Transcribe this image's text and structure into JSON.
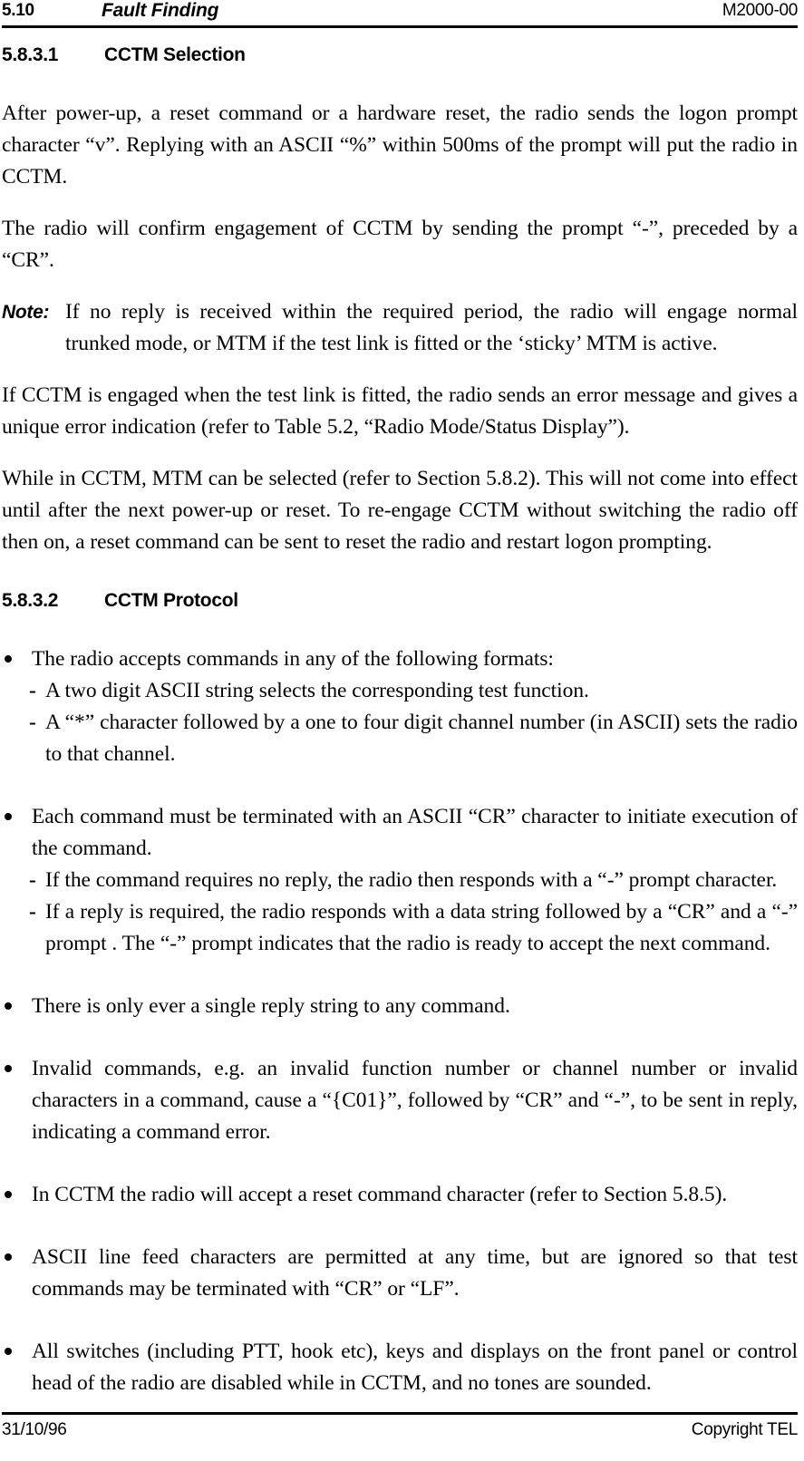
{
  "header": {
    "section_number": "5.10",
    "title": "Fault Finding",
    "document_number": "M2000-00"
  },
  "footer": {
    "date": "31/10/96",
    "copyright": "Copyright TEL"
  },
  "sections": [
    {
      "number": "5.8.3.1",
      "title": "CCTM Selection"
    },
    {
      "number": "5.8.3.2",
      "title": "CCTM Protocol"
    }
  ],
  "paragraphs": {
    "p1": "After power-up, a reset command or a hardware reset, the radio sends the logon prompt character “v”. Replying with an ASCII “%” within 500ms of the prompt will put the radio in CCTM.",
    "p2": "The radio will confirm engagement of CCTM by sending the prompt “-”, preceded by a “CR”.",
    "p3": "If CCTM is engaged when the test link is fitted, the radio sends an error message and gives a unique error indication (refer to Table 5.2, “Radio Mode/Status Display”).",
    "p4": "While in CCTM, MTM can be selected (refer to Section 5.8.2). This will not come into effect until after the next power-up or reset. To re-engage CCTM without switching the radio off then on, a reset command can be sent to reset the radio and restart logon prompting."
  },
  "note": {
    "label": "Note:",
    "text": "If no reply is received within the required period, the radio will engage normal trunked mode, or MTM if the test link is fitted or the ‘sticky’ MTM is active."
  },
  "bullet_marker": "•",
  "subbullet_marker": "-",
  "protocol_list": [
    {
      "text": "The radio accepts commands in any of the following formats:",
      "sub": [
        "A two digit ASCII string selects the corresponding test function.",
        "A “*” character followed by a one to four digit channel number (in ASCII) sets the radio to that channel."
      ]
    },
    {
      "text": "Each command must be terminated with an ASCII “CR” character to initiate execution of the command.",
      "sub": [
        "If the command requires no reply, the radio then responds with a “-” prompt character.",
        "If a reply is required, the radio responds with a data string followed by a “CR” and a “-” prompt . The “-” prompt indicates that the radio is ready to accept the next command."
      ]
    },
    {
      "text": "There is only ever a single reply string to any command.",
      "sub": []
    },
    {
      "text": "Invalid commands, e.g. an invalid function number or channel number or invalid characters in a command, cause a “{C01}”, followed by “CR” and “-”, to be sent in reply, indicating a command error.",
      "sub": []
    },
    {
      "text": "In CCTM the radio will accept a reset command character (refer to Section 5.8.5).",
      "sub": []
    },
    {
      "text": "ASCII line feed characters are permitted at any time, but are ignored so that test commands may be terminated with “CR” or “LF”.",
      "sub": []
    },
    {
      "text": "All switches (including PTT, hook etc), keys and displays on the front panel or control head of the radio are disabled while in CCTM, and no tones are sounded.",
      "sub": []
    }
  ]
}
